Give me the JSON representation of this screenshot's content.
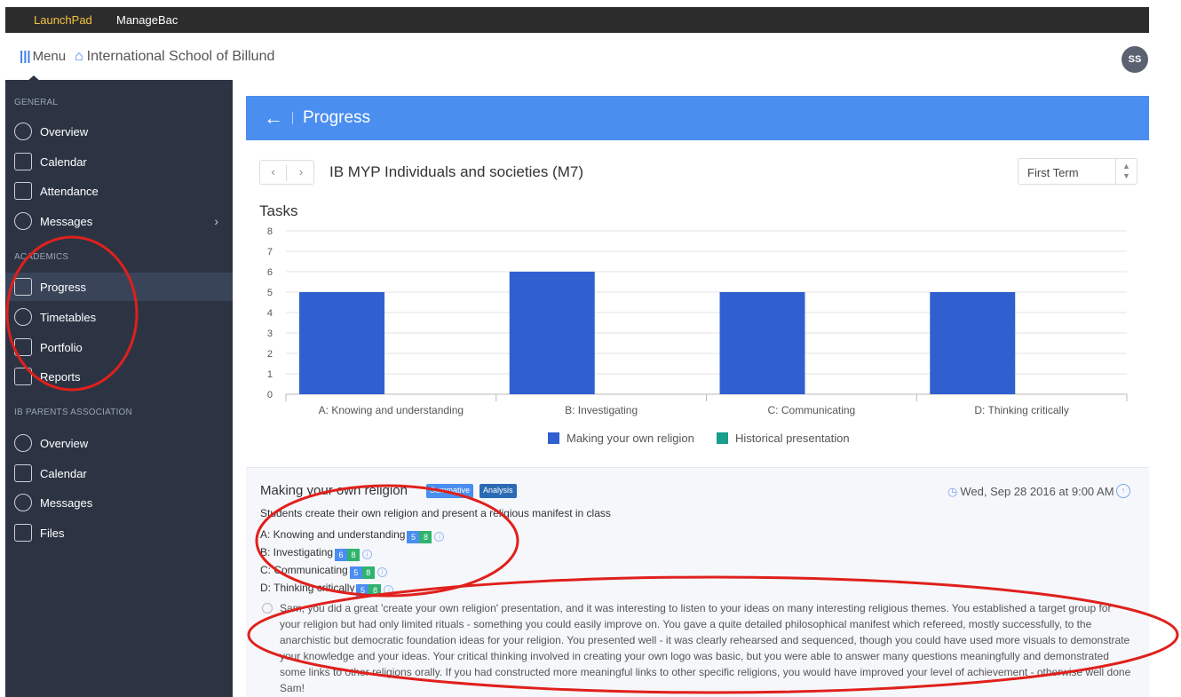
{
  "topbar": {
    "launchpad": "LaunchPad",
    "managebac": "ManageBac"
  },
  "header": {
    "menu_label": "Menu",
    "school_name": "International School of Billund",
    "avatar_initials": "SS"
  },
  "sidebar": {
    "general_heading": "GENERAL",
    "general_items": [
      {
        "label": "Overview",
        "icon": "dashboard-icon"
      },
      {
        "label": "Calendar",
        "icon": "calendar-icon"
      },
      {
        "label": "Attendance",
        "icon": "attendance-icon"
      },
      {
        "label": "Messages",
        "icon": "messages-icon"
      }
    ],
    "academics_heading": "ACADEMICS",
    "academics_items": [
      {
        "label": "Progress",
        "icon": "bookmark-icon",
        "active": true
      },
      {
        "label": "Timetables",
        "icon": "clock-icon"
      },
      {
        "label": "Portfolio",
        "icon": "portfolio-icon"
      },
      {
        "label": "Reports",
        "icon": "document-icon"
      }
    ],
    "parents_heading": "IB PARENTS ASSOCIATION",
    "parents_items": [
      {
        "label": "Overview",
        "icon": "dashboard-icon"
      },
      {
        "label": "Calendar",
        "icon": "calendar-icon"
      },
      {
        "label": "Messages",
        "icon": "messages-icon"
      },
      {
        "label": "Files",
        "icon": "files-icon"
      }
    ]
  },
  "page": {
    "title": "Progress",
    "back_icon": "arrow-left-icon",
    "course_title": "IB MYP Individuals and societies (M7)",
    "term": "First Term",
    "chart_heading": "Tasks"
  },
  "chart_data": {
    "type": "bar",
    "title": "Tasks",
    "categories": [
      "A: Knowing and understanding",
      "B: Investigating",
      "C: Communicating",
      "D: Thinking critically"
    ],
    "series": [
      {
        "name": "Making your own religion",
        "values": [
          5,
          6,
          5,
          5
        ],
        "color": "#3060d0"
      },
      {
        "name": "Historical presentation",
        "values": [
          0,
          0,
          0,
          0
        ],
        "color": "#179e8c"
      }
    ],
    "ylim": [
      0,
      8
    ],
    "yticks": [
      0,
      1,
      2,
      3,
      4,
      5,
      6,
      7,
      8
    ],
    "grid": true,
    "legend_position": "bottom"
  },
  "task": {
    "name": "Making your own religion",
    "badge_1": "Summative",
    "badge_2": "Analysis",
    "date": "Wed, Sep 28 2016 at 9:00 AM",
    "description": "Students create their own religion and present a religious manifest in class",
    "criteria": [
      {
        "label": "A: Knowing and understanding",
        "score": "5",
        "max": "8"
      },
      {
        "label": "B: Investigating",
        "score": "6",
        "max": "8"
      },
      {
        "label": "C: Communicating",
        "score": "5",
        "max": "8"
      },
      {
        "label": "D: Thinking critically",
        "score": "5",
        "max": "8"
      }
    ],
    "comment": "Sam, you did a great 'create your own religion' presentation, and it was interesting to listen to your ideas on many interesting religious themes. You established a target group for your religion but had only limited rituals - something you could easily improve on. You gave a quite detailed philosophical manifest which refereed, mostly successfully, to the anarchistic but democratic foundation ideas for your religion. You presented well - it was clearly rehearsed and sequenced, though you could have used more visuals to demonstrate your knowledge and your ideas. Your critical thinking involved in creating your own logo was basic, but you were able to answer many questions meaningfully and demonstrated some links to other religions orally. If you had constructed more meaningful links to other specific religions, you would have improved your level of achievement - otherwise well done Sam!"
  },
  "colors": {
    "accent": "#4a8ef0",
    "sidebar_bg": "#2c3444",
    "annotation": "#e0201c"
  }
}
